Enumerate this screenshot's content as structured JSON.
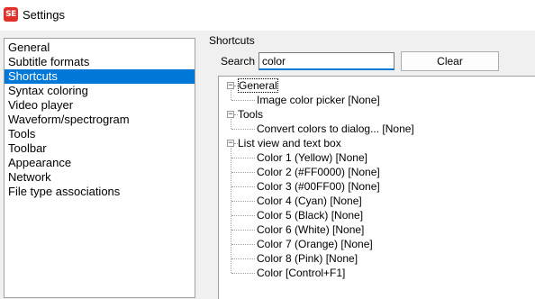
{
  "window": {
    "title": "Settings",
    "icon": "subtitle-edit-app-icon",
    "icon_text": "SE"
  },
  "categories": [
    {
      "label": "General",
      "selected": false
    },
    {
      "label": "Subtitle formats",
      "selected": false
    },
    {
      "label": "Shortcuts",
      "selected": true
    },
    {
      "label": "Syntax coloring",
      "selected": false
    },
    {
      "label": "Video player",
      "selected": false
    },
    {
      "label": "Waveform/spectrogram",
      "selected": false
    },
    {
      "label": "Tools",
      "selected": false
    },
    {
      "label": "Toolbar",
      "selected": false
    },
    {
      "label": "Appearance",
      "selected": false
    },
    {
      "label": "Network",
      "selected": false
    },
    {
      "label": "File type associations",
      "selected": false
    }
  ],
  "shortcuts": {
    "section_label": "Shortcuts",
    "search_label": "Search",
    "search_value": "color",
    "clear_label": "Clear",
    "tree": [
      {
        "label": "General",
        "expanded": true,
        "children": [
          "Image color picker [None]"
        ]
      },
      {
        "label": "Tools",
        "expanded": true,
        "children": [
          "Convert colors to dialog... [None]"
        ]
      },
      {
        "label": "List view and text box",
        "expanded": true,
        "children": [
          "Color 1 (Yellow) [None]",
          "Color 2 (#FF0000) [None]",
          "Color 3 (#00FF00) [None]",
          "Color 4 (Cyan) [None]",
          "Color 5 (Black) [None]",
          "Color 6 (White) [None]",
          "Color 7 (Orange) [None]",
          "Color 8 (Pink) [None]",
          "Color [Control+F1]"
        ]
      }
    ]
  },
  "colors": {
    "selection": "#0078d7",
    "app_icon": "#e0312a"
  }
}
